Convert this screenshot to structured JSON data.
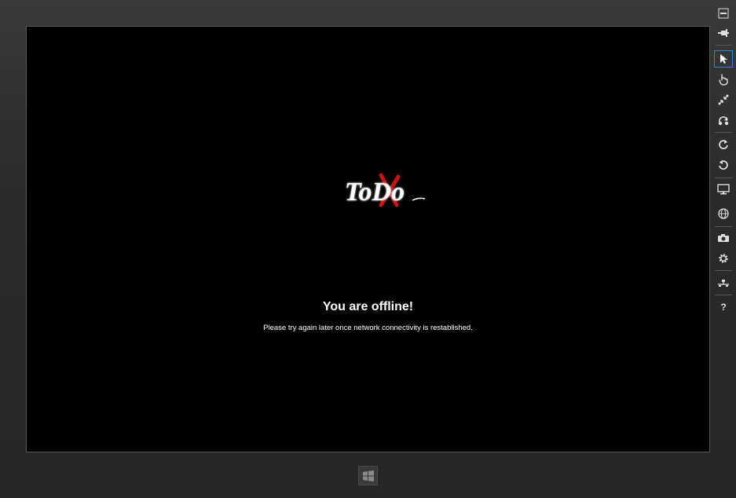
{
  "app": {
    "logo_text": "ToDo"
  },
  "message": {
    "title": "You are offline!",
    "body": "Please try again later once network connectivity is restablished."
  },
  "toolbar": {
    "help_label": "?"
  },
  "colors": {
    "accent_selection": "#3c7fd0",
    "logo_cross": "#cc1111",
    "screen_bg": "#000000",
    "bezel_bg": "#2b2b2b"
  },
  "icons": [
    "minimize-icon",
    "pin-icon",
    "mouse-pointer-icon",
    "touch-hand-icon",
    "pinch-zoom-icon",
    "rotate-touch-icon",
    "rotate-clockwise-icon",
    "rotate-counterclockwise-icon",
    "resolution-monitor-icon",
    "location-globe-icon",
    "screenshot-camera-icon",
    "settings-gear-icon",
    "network-icon",
    "help-icon",
    "windows-logo-icon"
  ]
}
